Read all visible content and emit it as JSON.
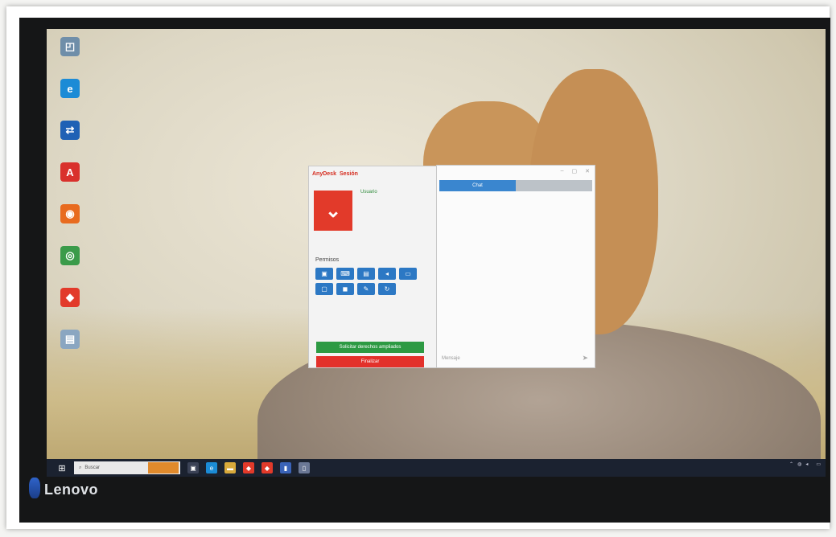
{
  "monitor": {
    "brand": "Lenovo"
  },
  "desktop_icons": [
    {
      "name": "this-pc-icon",
      "glyph": "◰",
      "color": "#6f8ea9",
      "label": ""
    },
    {
      "name": "edge-icon",
      "glyph": "e",
      "color": "#1b8bd6",
      "label": ""
    },
    {
      "name": "teamviewer-icon",
      "glyph": "⇄",
      "color": "#1f61b5",
      "label": ""
    },
    {
      "name": "acrobat-icon",
      "glyph": "A",
      "color": "#d9312c",
      "label": ""
    },
    {
      "name": "firefox-icon",
      "glyph": "◉",
      "color": "#e86b1f",
      "label": ""
    },
    {
      "name": "chrome-icon",
      "glyph": "◎",
      "color": "#3b9b4a",
      "label": ""
    },
    {
      "name": "anydesk-icon",
      "glyph": "◆",
      "color": "#e23a2a",
      "label": ""
    },
    {
      "name": "file-icon",
      "glyph": "▤",
      "color": "#8aa6c1",
      "label": ""
    }
  ],
  "anydesk": {
    "app_name": "AnyDesk",
    "tab_label": "Sesión",
    "user_name": "Usuario",
    "user_id": "",
    "description": "",
    "id_label": "",
    "permissions_title": "Permisos",
    "permission_icons": [
      "monitor-icon",
      "keyboard-icon",
      "clipboard-icon",
      "sound-icon",
      "chat-icon",
      "file-transfer-icon",
      "lock-icon",
      "draw-icon",
      "restart-icon"
    ],
    "elevate_button": "Solicitar derechos ampliados",
    "end_button": "Finalizar"
  },
  "chat": {
    "tab_chat": "Chat",
    "tab_transfer": "",
    "heading": "",
    "entries": [
      {
        "who": "",
        "text": "",
        "time": ""
      },
      {
        "who": "",
        "text": "",
        "time": ""
      }
    ],
    "message_placeholder": "Mensaje"
  },
  "taskbar": {
    "search_placeholder": "Buscar",
    "pinned": [
      {
        "name": "task-view-icon",
        "glyph": "▣",
        "color": "#3b4256"
      },
      {
        "name": "edge-taskbar-icon",
        "glyph": "e",
        "color": "#1b8bd6"
      },
      {
        "name": "explorer-taskbar-icon",
        "glyph": "▬",
        "color": "#d8a93b"
      },
      {
        "name": "anydesk-taskbar-icon",
        "glyph": "◆",
        "color": "#e23a2a"
      },
      {
        "name": "anydesk-taskbar-icon-2",
        "glyph": "◆",
        "color": "#e23a2a"
      },
      {
        "name": "app-taskbar-icon",
        "glyph": "▮",
        "color": "#3a63b8"
      },
      {
        "name": "app-taskbar-icon-2",
        "glyph": "▯",
        "color": "#6b7896"
      }
    ],
    "clock": ""
  }
}
